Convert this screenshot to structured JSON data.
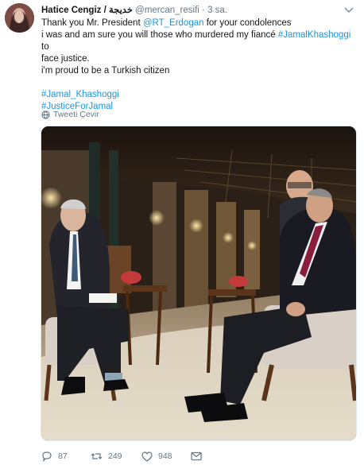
{
  "tweet": {
    "author_name": "Hatice Cengiz / خديجة",
    "handle": "@mercan_resifi",
    "separator": "·",
    "time": "3 sa.",
    "text_lines": [
      {
        "before": "Thank you Mr. President ",
        "link": "@RT_Erdogan",
        "after": " for your condolences"
      },
      {
        "before": "i was and am sure you will those who murdered my fiancé ",
        "link": "#JamalKhashoggi",
        "after": " to"
      },
      {
        "before": "face justice.",
        "link": "",
        "after": ""
      },
      {
        "before": "i'm proud to be a Turkish citizen",
        "link": "",
        "after": ""
      }
    ],
    "hashtags": [
      "#Jamal_Khashoggi",
      "#JusticeForJamal"
    ],
    "translate_label": "Tweeti Çevir",
    "actions": {
      "reply_count": "87",
      "retweet_count": "249",
      "like_count": "948"
    },
    "icons": [
      "avatar",
      "chevron-down-icon",
      "globe-icon",
      "reply-icon",
      "retweet-icon",
      "like-icon",
      "direct-message-icon"
    ],
    "colors": {
      "link": "#1b95e0",
      "muted": "#657786",
      "text": "#14171a"
    }
  }
}
